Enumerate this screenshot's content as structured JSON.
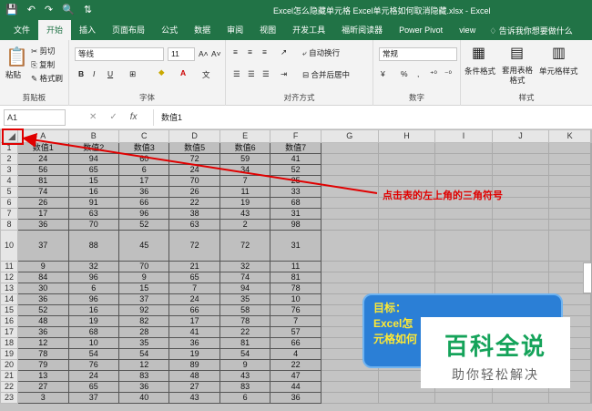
{
  "window": {
    "title": "Excel怎么隐藏单元格 Excel单元格如何取消隐藏.xlsx - Excel",
    "quick_access": [
      "💾",
      "↶",
      "↷",
      "🔍",
      "⇅"
    ]
  },
  "ribbon_tabs": [
    "文件",
    "开始",
    "插入",
    "页面布局",
    "公式",
    "数据",
    "审阅",
    "视图",
    "开发工具",
    "福昕阅读器",
    "Power Pivot",
    "view"
  ],
  "active_tab": "开始",
  "tell_me": "告诉我你想要做什么",
  "ribbon": {
    "clipboard": {
      "paste": "粘贴",
      "cut": "剪切",
      "copy": "复制",
      "format_painter": "格式刷",
      "label": "剪贴板"
    },
    "font": {
      "name": "等线",
      "size": "11",
      "grow": "A˄",
      "shrink": "A˅",
      "bold": "B",
      "italic": "I",
      "underline": "U",
      "label": "字体"
    },
    "alignment": {
      "wrap": "自动换行",
      "merge": "合并后居中",
      "label": "对齐方式"
    },
    "number": {
      "format": "常规",
      "percent": "%",
      "comma": ",",
      "label": "数字"
    },
    "styles": {
      "conditional": "条件格式",
      "table": "套用表格格式",
      "cell": "单元格样式",
      "label": "样式"
    }
  },
  "formula_bar": {
    "name_box": "A1",
    "cancel": "✕",
    "enter": "✓",
    "fx": "fx",
    "value": "数值1"
  },
  "sheet": {
    "columns": [
      "A",
      "B",
      "C",
      "D",
      "E",
      "F",
      "G",
      "H",
      "I",
      "J",
      "K"
    ],
    "header_row": [
      "数值1",
      "数值2",
      "数值3",
      "数值5",
      "数值6",
      "数值7"
    ],
    "rows": [
      {
        "num": "2",
        "cells": [
          "24",
          "94",
          "60",
          "72",
          "59",
          "41"
        ]
      },
      {
        "num": "3",
        "cells": [
          "56",
          "65",
          "6",
          "24",
          "34",
          "52"
        ]
      },
      {
        "num": "4",
        "cells": [
          "81",
          "15",
          "17",
          "70",
          "7",
          "25"
        ]
      },
      {
        "num": "5",
        "cells": [
          "74",
          "16",
          "36",
          "26",
          "11",
          "33"
        ]
      },
      {
        "num": "6",
        "cells": [
          "26",
          "91",
          "66",
          "22",
          "19",
          "68"
        ]
      },
      {
        "num": "7",
        "cells": [
          "17",
          "63",
          "96",
          "38",
          "43",
          "31"
        ]
      },
      {
        "num": "8",
        "cells": [
          "36",
          "70",
          "52",
          "63",
          "2",
          "98"
        ]
      },
      {
        "num": "10",
        "cells": [
          "37",
          "88",
          "45",
          "72",
          "72",
          "31"
        ],
        "tall": true
      },
      {
        "num": "11",
        "cells": [
          "9",
          "32",
          "70",
          "21",
          "32",
          "11"
        ]
      },
      {
        "num": "12",
        "cells": [
          "84",
          "96",
          "9",
          "65",
          "74",
          "81"
        ]
      },
      {
        "num": "13",
        "cells": [
          "30",
          "6",
          "15",
          "7",
          "94",
          "78"
        ]
      },
      {
        "num": "14",
        "cells": [
          "36",
          "96",
          "37",
          "24",
          "35",
          "10"
        ]
      },
      {
        "num": "15",
        "cells": [
          "52",
          "16",
          "92",
          "66",
          "58",
          "76"
        ]
      },
      {
        "num": "16",
        "cells": [
          "48",
          "19",
          "82",
          "17",
          "78",
          "7"
        ]
      },
      {
        "num": "17",
        "cells": [
          "36",
          "68",
          "28",
          "41",
          "22",
          "57"
        ]
      },
      {
        "num": "18",
        "cells": [
          "12",
          "10",
          "35",
          "36",
          "81",
          "66"
        ]
      },
      {
        "num": "19",
        "cells": [
          "78",
          "54",
          "54",
          "19",
          "54",
          "4"
        ]
      },
      {
        "num": "20",
        "cells": [
          "79",
          "76",
          "12",
          "89",
          "9",
          "22"
        ]
      },
      {
        "num": "21",
        "cells": [
          "13",
          "24",
          "83",
          "48",
          "43",
          "47"
        ]
      },
      {
        "num": "22",
        "cells": [
          "27",
          "65",
          "36",
          "27",
          "83",
          "44"
        ]
      },
      {
        "num": "23",
        "cells": [
          "3",
          "37",
          "40",
          "43",
          "6",
          "36"
        ]
      }
    ]
  },
  "annotation": "点击表的左上角的三角符号",
  "callout": {
    "line1": "目标：",
    "line2": "Excel怎",
    "line3": "元格如何"
  },
  "watermark": {
    "big": "百科全说",
    "small": "助你轻松解决"
  },
  "colors": {
    "excel_green": "#217346",
    "annotation_red": "#e00000",
    "callout_blue": "#2b7fd6",
    "callout_text": "#ffe933",
    "watermark_green": "#15a35a"
  }
}
